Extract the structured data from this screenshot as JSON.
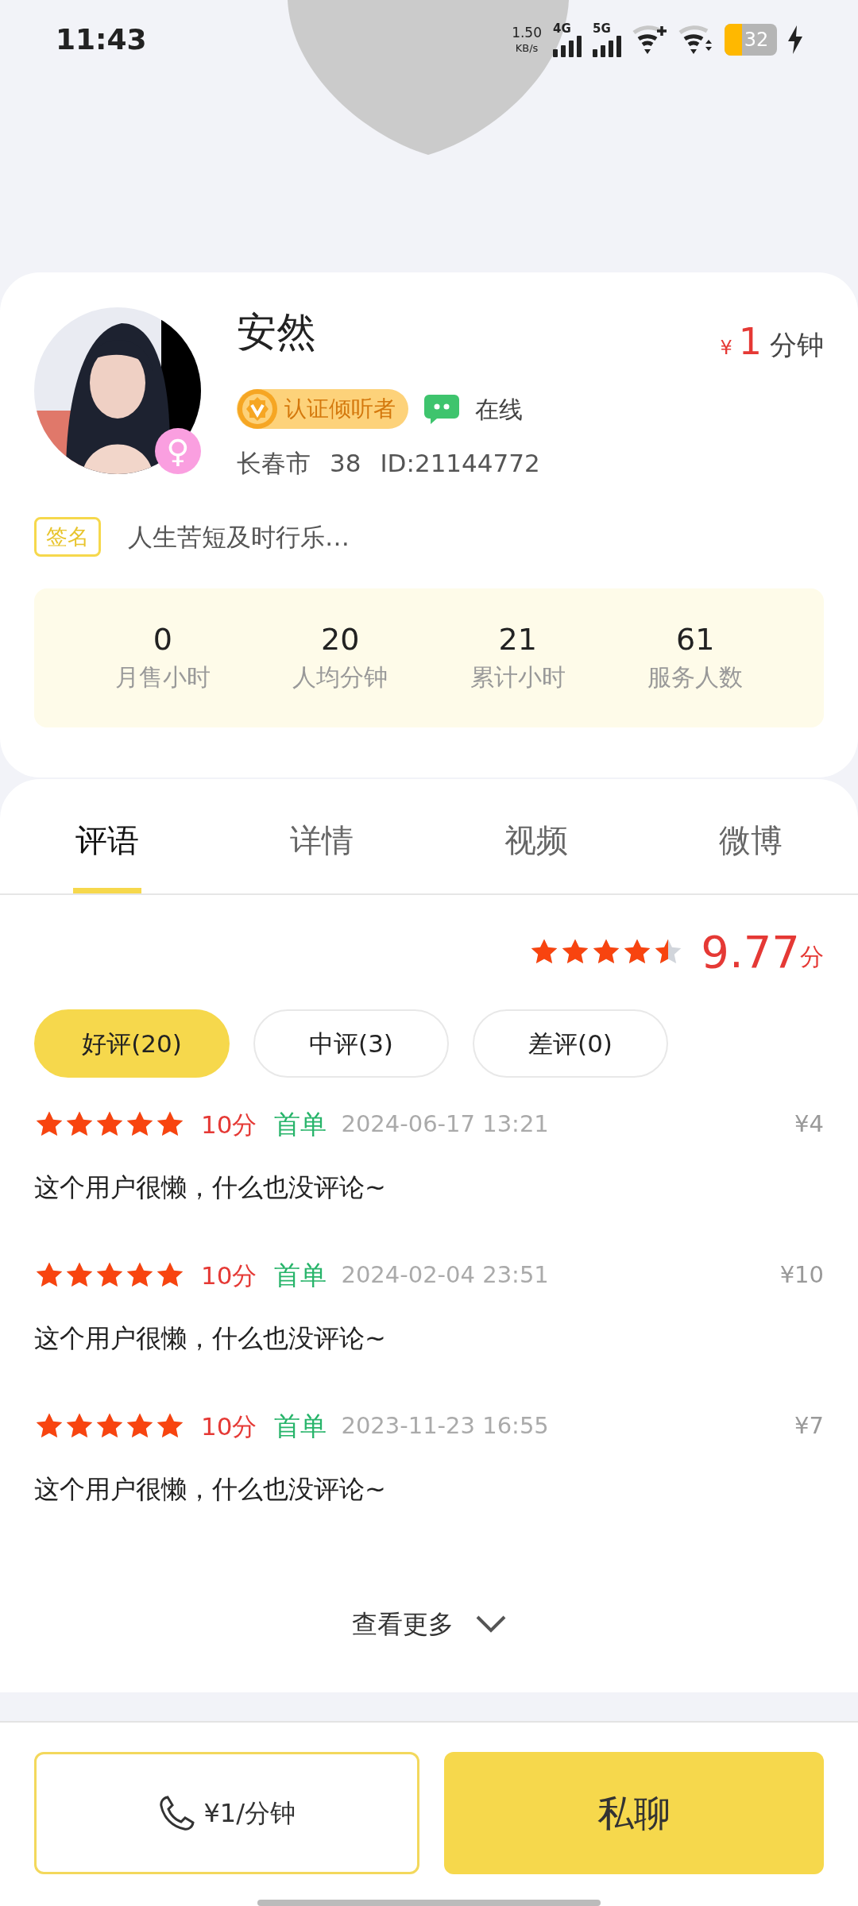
{
  "status_bar": {
    "time": "11:43",
    "net_speed": "1.50",
    "net_unit": "KB/s",
    "networks": [
      "4G",
      "5G"
    ],
    "battery": "32",
    "charging": true
  },
  "profile": {
    "name": "安然",
    "price": {
      "currency": "¥",
      "amount": "1",
      "unit": "分钟"
    },
    "gender_symbol": "♀",
    "badge": "认证倾听者",
    "status": "在线",
    "location": "长春市",
    "age": "38",
    "id": "ID:21144772",
    "signature_label": "签名",
    "signature": "人生苦短及时行乐…"
  },
  "stats": [
    {
      "value": "0",
      "label": "月售小时"
    },
    {
      "value": "20",
      "label": "人均分钟"
    },
    {
      "value": "21",
      "label": "累计小时"
    },
    {
      "value": "61",
      "label": "服务人数"
    }
  ],
  "tabs": [
    {
      "label": "评语",
      "selected": true
    },
    {
      "label": "详情",
      "selected": false
    },
    {
      "label": "视频",
      "selected": false
    },
    {
      "label": "微博",
      "selected": false
    }
  ],
  "rating": {
    "stars": 4.5,
    "score": "9.77",
    "unit": "分"
  },
  "filters": [
    {
      "label": "好评(20)",
      "selected": true
    },
    {
      "label": "中评(3)",
      "selected": false
    },
    {
      "label": "差评(0)",
      "selected": false
    }
  ],
  "reviews": [
    {
      "stars": 5,
      "score": "10分",
      "tag": "首单",
      "time": "2024-06-17 13:21",
      "price": "¥4",
      "comment": "这个用户很懒，什么也没评论~"
    },
    {
      "stars": 5,
      "score": "10分",
      "tag": "首单",
      "time": "2024-02-04 23:51",
      "price": "¥10",
      "comment": "这个用户很懒，什么也没评论~"
    },
    {
      "stars": 5,
      "score": "10分",
      "tag": "首单",
      "time": "2023-11-23 16:55",
      "price": "¥7",
      "comment": "这个用户很懒，什么也没评论~"
    }
  ],
  "see_more": "查看更多",
  "actions": {
    "call": "¥1/分钟",
    "chat": "私聊"
  }
}
